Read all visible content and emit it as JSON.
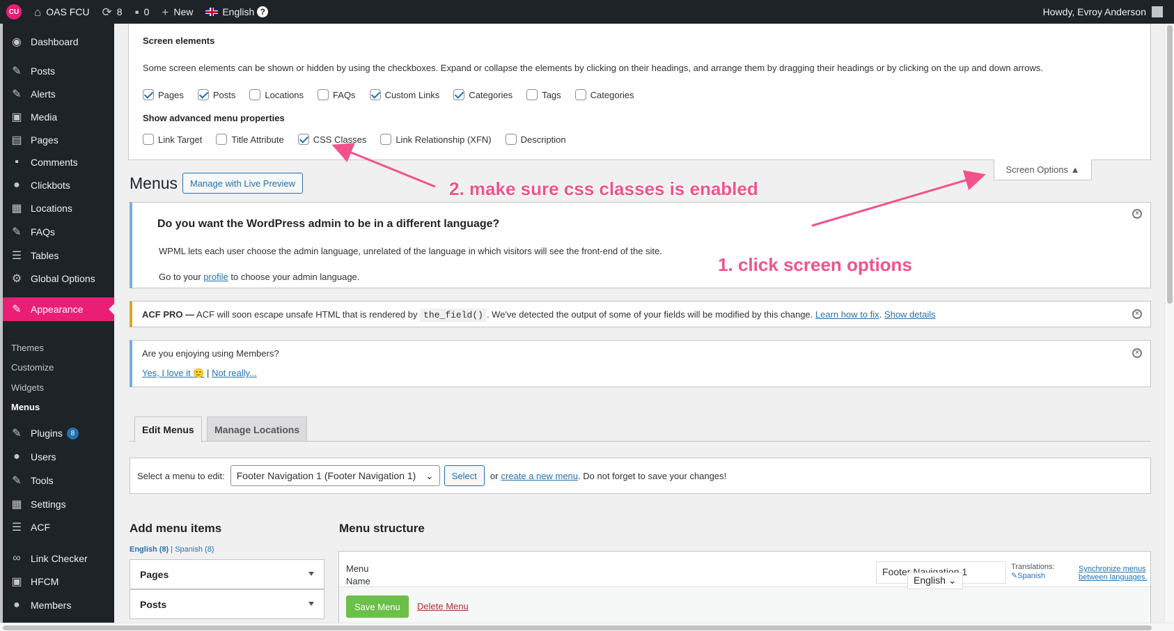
{
  "adminbar": {
    "logo": "CU",
    "site_name": "OAS FCU",
    "updates_count": "8",
    "comments_count": "0",
    "new_label": "New",
    "language_label": "English",
    "help_label": "?",
    "howdy": "Howdy, Evroy Anderson"
  },
  "sidebar": {
    "items": [
      {
        "label": "Dashboard",
        "icon": "dashboard-icon"
      },
      {
        "label": "Posts",
        "icon": "pin-icon"
      },
      {
        "label": "Alerts",
        "icon": "pin-icon"
      },
      {
        "label": "Media",
        "icon": "media-icon"
      },
      {
        "label": "Pages",
        "icon": "pages-icon"
      },
      {
        "label": "Comments",
        "icon": "comment-icon"
      },
      {
        "label": "Clickbots",
        "icon": "chat-icon"
      },
      {
        "label": "Locations",
        "icon": "grid-icon"
      },
      {
        "label": "FAQs",
        "icon": "pin-icon"
      },
      {
        "label": "Tables",
        "icon": "table-icon"
      },
      {
        "label": "Global Options",
        "icon": "gear-icon"
      },
      {
        "label": "Appearance",
        "icon": "brush-icon"
      },
      {
        "label": "Plugins",
        "icon": "plug-icon",
        "badge": "8"
      },
      {
        "label": "Users",
        "icon": "user-icon"
      },
      {
        "label": "Tools",
        "icon": "wrench-icon"
      },
      {
        "label": "Settings",
        "icon": "settings-icon"
      },
      {
        "label": "ACF",
        "icon": "acf-icon"
      },
      {
        "label": "Link Checker",
        "icon": "link-icon"
      },
      {
        "label": "HFCM",
        "icon": "robot-icon"
      },
      {
        "label": "Members",
        "icon": "members-icon"
      }
    ],
    "submenu": [
      "Themes",
      "Customize",
      "Widgets",
      "Menus"
    ]
  },
  "screen_options": {
    "title": "Screen elements",
    "description": "Some screen elements can be shown or hidden by using the checkboxes. Expand or collapse the elements by clicking on their headings, and arrange them by dragging their headings or by clicking on the up and down arrows.",
    "elements": [
      {
        "label": "Pages",
        "checked": true
      },
      {
        "label": "Posts",
        "checked": true
      },
      {
        "label": "Locations",
        "checked": false
      },
      {
        "label": "FAQs",
        "checked": false
      },
      {
        "label": "Custom Links",
        "checked": true
      },
      {
        "label": "Categories",
        "checked": true
      },
      {
        "label": "Tags",
        "checked": false
      },
      {
        "label": "Categories",
        "checked": false
      }
    ],
    "advanced_title": "Show advanced menu properties",
    "advanced": [
      {
        "label": "Link Target",
        "checked": false
      },
      {
        "label": "Title Attribute",
        "checked": false
      },
      {
        "label": "CSS Classes",
        "checked": true
      },
      {
        "label": "Link Relationship (XFN)",
        "checked": false
      },
      {
        "label": "Description",
        "checked": false
      }
    ],
    "toggle_label": "Screen Options ▲"
  },
  "page": {
    "title": "Menus",
    "preview_button": "Manage with Live Preview"
  },
  "notices": {
    "wpml": {
      "heading": "Do you want the WordPress admin to be in a different language?",
      "body": "WPML lets each user choose the admin language, unrelated of the language in which visitors will see the front-end of the site.",
      "go_prefix": "Go to your",
      "profile_link": "profile",
      "go_suffix": "to choose your admin language."
    },
    "acf": {
      "bold": "ACF PRO —",
      "text1": "ACF will soon escape unsafe HTML that is rendered by",
      "code": "the_field()",
      "text2": ". We've detected the output of some of your fields will be modified by this change.",
      "learn_link": "Learn how to fix",
      "details_link": "Show details"
    },
    "members": {
      "question": "Are you enjoying using Members?",
      "yes_link": "Yes, I love it 🙂",
      "sep": "|",
      "no_link": "Not really..."
    },
    "dismiss": "×"
  },
  "tabs": {
    "edit": "Edit Menus",
    "manage": "Manage Locations"
  },
  "manage": {
    "label": "Select a menu to edit:",
    "selected": "Footer Navigation 1 (Footer Navigation 1)",
    "select_button": "Select",
    "or_text": "or",
    "create_link": "create a new menu",
    "suffix": ". Do not forget to save your changes!"
  },
  "add_items": {
    "title": "Add menu items",
    "lang_current": "English (8)",
    "lang_sep": "|",
    "lang_other": "Spanish (8)",
    "sections": [
      "Pages",
      "Posts"
    ]
  },
  "structure": {
    "title": "Menu structure",
    "name_label_1": "Menu",
    "name_label_2": "Name",
    "name_value": "Footer Navigation 1",
    "lang_dropdown": "English",
    "translations_label": "Translations:",
    "spanish_link": "Spanish",
    "sync_link_1": "Synchronize menus",
    "sync_link_2": "between languages.",
    "save_button": "Save Menu",
    "delete_link": "Delete Menu"
  },
  "annotations": {
    "step1": "1. click screen options",
    "step2": "2. make sure css classes is enabled",
    "color": "#f2528a"
  }
}
